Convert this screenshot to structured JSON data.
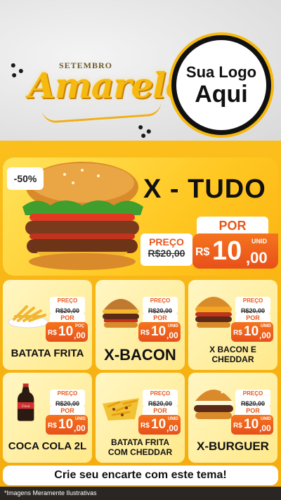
{
  "header": {
    "kicker": "SETEMBRO",
    "title": "Amarelo",
    "logo_line1": "Sua Logo",
    "logo_line2": "Aqui"
  },
  "hero": {
    "discount": "-50%",
    "title": "X - TUDO",
    "preco_label": "PREÇO",
    "old_price": "R$20,00",
    "por_label": "POR",
    "currency": "R$",
    "price_int": "10",
    "price_dec": ",00",
    "unit": "UNID"
  },
  "products": [
    {
      "name": "BATATA FRITA",
      "preco_label": "PREÇO",
      "old_price": "R$20,00",
      "por_label": "POR",
      "currency": "R$",
      "price_int": "10",
      "price_dec": ",00",
      "unit": "POÇ",
      "icon": "fries-icon"
    },
    {
      "name": "X-BACON",
      "preco_label": "PREÇO",
      "old_price": "R$20,00",
      "por_label": "POR",
      "currency": "R$",
      "price_int": "10",
      "price_dec": ",00",
      "unit": "UNID",
      "icon": "burger-icon"
    },
    {
      "name": "X BACON E CHEDDAR",
      "preco_label": "PREÇO",
      "old_price": "R$20,00",
      "por_label": "POR",
      "currency": "R$",
      "price_int": "10",
      "price_dec": ",00",
      "unit": "UNID",
      "icon": "burger-icon"
    },
    {
      "name": "COCA COLA 2L",
      "preco_label": "PREÇO",
      "old_price": "R$20,00",
      "por_label": "POR",
      "currency": "R$",
      "price_int": "10",
      "price_dec": ",00",
      "unit": "UNID",
      "icon": "soda-bottle-icon"
    },
    {
      "name": "BATATA FRITA COM CHEDDAR",
      "preco_label": "PREÇO",
      "old_price": "R$20,00",
      "por_label": "POR",
      "currency": "R$",
      "price_int": "10",
      "price_dec": ",00",
      "unit": "UNID",
      "icon": "fries-icon"
    },
    {
      "name": "X-BURGUER",
      "preco_label": "PREÇO",
      "old_price": "R$20,00",
      "por_label": "POR",
      "currency": "R$",
      "price_int": "10",
      "price_dec": ",00",
      "unit": "UNID",
      "icon": "burger-icon"
    }
  ],
  "cta": "Crie seu encarte com este tema!",
  "footer_note": "*Imagens Meramente Ilustrativas",
  "colors": {
    "yellow": "#f7b514",
    "orange": "#e8501a",
    "dark": "#111111"
  }
}
